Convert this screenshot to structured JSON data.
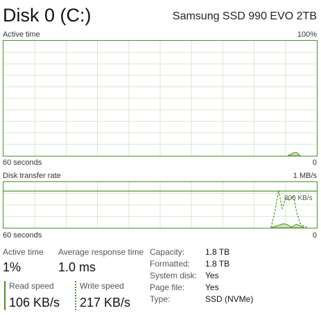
{
  "header": {
    "title": "Disk 0 (C:)",
    "model": "Samsung SSD 990 EVO 2TB"
  },
  "active_graph": {
    "label": "Active time",
    "max_label": "100%",
    "time_label": "60 seconds",
    "zero_label": "0",
    "value_pct": 1
  },
  "transfer_graph": {
    "label": "Disk transfer rate",
    "max_label": "1 MB/s",
    "scale_line_label": "800 KB/s",
    "time_label": "60 seconds",
    "zero_label": "0"
  },
  "stats": {
    "active_time_label": "Active time",
    "active_time_value": "1%",
    "avg_response_label": "Average response time",
    "avg_response_value": "1.0 ms",
    "read_label": "Read speed",
    "read_value": "106 KB/s",
    "write_label": "Write speed",
    "write_value": "217 KB/s"
  },
  "properties": [
    {
      "key": "Capacity:",
      "value": "1.8 TB"
    },
    {
      "key": "Formatted:",
      "value": "1.8 TB"
    },
    {
      "key": "System disk:",
      "value": "Yes"
    },
    {
      "key": "Page file:",
      "value": "Yes"
    },
    {
      "key": "Type:",
      "value": "SSD (NVMe)"
    }
  ],
  "colors": {
    "accent": "#4e8f20",
    "grid": "#d9e8cc"
  }
}
